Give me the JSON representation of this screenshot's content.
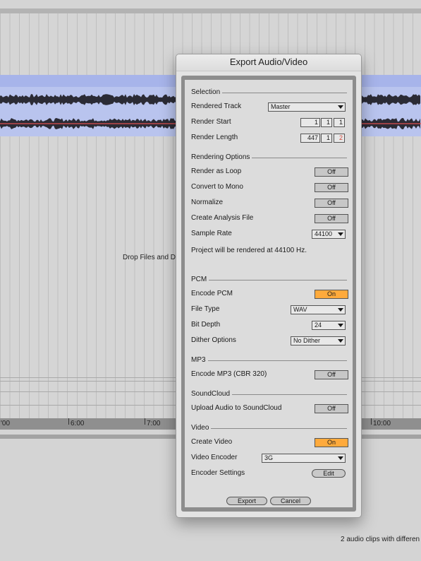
{
  "background": {
    "drop_text": "Drop Files and De",
    "timeline_ticks": [
      "'00",
      "6:00",
      "7:00",
      "10:00"
    ],
    "status_text": "2 audio clips with differen"
  },
  "dialog": {
    "title": "Export Audio/Video",
    "selection": {
      "header": "Selection",
      "rendered_track_label": "Rendered Track",
      "rendered_track_value": "Master",
      "render_start_label": "Render Start",
      "render_start": [
        "1",
        "1",
        "1"
      ],
      "render_length_label": "Render Length",
      "render_length": [
        "447",
        "1",
        "2"
      ]
    },
    "rendering_options": {
      "header": "Rendering Options",
      "render_as_loop_label": "Render as Loop",
      "render_as_loop_value": "Off",
      "convert_to_mono_label": "Convert to Mono",
      "convert_to_mono_value": "Off",
      "normalize_label": "Normalize",
      "normalize_value": "Off",
      "create_analysis_label": "Create Analysis File",
      "create_analysis_value": "Off",
      "sample_rate_label": "Sample Rate",
      "sample_rate_value": "44100",
      "note": "Project will be rendered at 44100 Hz."
    },
    "pcm": {
      "header": "PCM",
      "encode_pcm_label": "Encode PCM",
      "encode_pcm_value": "On",
      "file_type_label": "File Type",
      "file_type_value": "WAV",
      "bit_depth_label": "Bit Depth",
      "bit_depth_value": "24",
      "dither_label": "Dither Options",
      "dither_value": "No Dither"
    },
    "mp3": {
      "header": "MP3",
      "encode_mp3_label": "Encode MP3 (CBR 320)",
      "encode_mp3_value": "Off"
    },
    "soundcloud": {
      "header": "SoundCloud",
      "upload_label": "Upload Audio to SoundCloud",
      "upload_value": "Off"
    },
    "video": {
      "header": "Video",
      "create_video_label": "Create Video",
      "create_video_value": "On",
      "encoder_label": "Video Encoder",
      "encoder_value": "3G",
      "settings_label": "Encoder Settings",
      "settings_button": "Edit"
    },
    "export_button": "Export",
    "cancel_button": "Cancel"
  },
  "colors": {
    "toggle_on": "#ffaa3c",
    "clip_header": "#a7b4ea",
    "clip_body": "#b9c4ee",
    "waveform": "#2b2b35",
    "waveform_line": "#e05050"
  }
}
